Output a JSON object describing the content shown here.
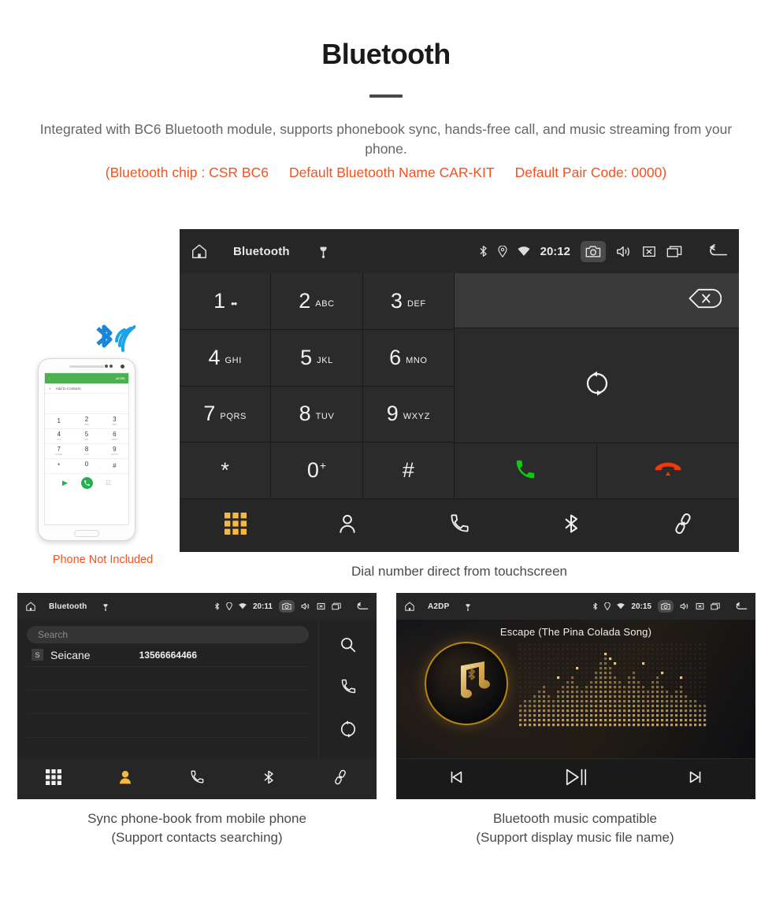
{
  "header": {
    "title": "Bluetooth",
    "description": "Integrated with BC6 Bluetooth module, supports phonebook sync, hands-free call, and music streaming from your phone.",
    "spec_open": "(Bluetooth chip : CSR BC6",
    "spec_name": "Default Bluetooth Name CAR-KIT",
    "spec_pair": "Default Pair Code: 0000)",
    "accent_color": "#f4511e",
    "text_color": "#666666"
  },
  "main_screen": {
    "statusbar": {
      "home_icon": "home-icon",
      "title": "Bluetooth",
      "usb_icon": "usb-icon",
      "bluetooth_icon": "bluetooth-icon",
      "location_icon": "location-icon",
      "wifi_icon": "wifi-icon",
      "clock": "20:12",
      "camera_icon": "camera-icon",
      "volume_icon": "volume-icon",
      "mute_icon": "mute-icon",
      "recents_icon": "recents-icon",
      "back_icon": "back-icon"
    },
    "keypad": [
      {
        "digit": "1",
        "letters": "",
        "voicemail": "oo"
      },
      {
        "digit": "2",
        "letters": "ABC",
        "voicemail": ""
      },
      {
        "digit": "3",
        "letters": "DEF",
        "voicemail": ""
      },
      {
        "digit": "4",
        "letters": "GHI",
        "voicemail": ""
      },
      {
        "digit": "5",
        "letters": "JKL",
        "voicemail": ""
      },
      {
        "digit": "6",
        "letters": "MNO",
        "voicemail": ""
      },
      {
        "digit": "7",
        "letters": "PQRS",
        "voicemail": ""
      },
      {
        "digit": "8",
        "letters": "TUV",
        "voicemail": ""
      },
      {
        "digit": "9",
        "letters": "WXYZ",
        "voicemail": ""
      },
      {
        "digit": "*",
        "letters": "",
        "voicemail": ""
      },
      {
        "digit": "0",
        "letters": "",
        "voicemail": "",
        "sup": "+"
      },
      {
        "digit": "#",
        "letters": "",
        "voicemail": ""
      }
    ],
    "number_field_value": "",
    "backspace_icon": "backspace-icon",
    "sync_icon": "sync-icon",
    "call_icon": "call-icon",
    "hangup_icon": "hangup-icon",
    "call_color": "#12c712",
    "hangup_color": "#f0380c",
    "tabs": [
      {
        "name": "dialpad",
        "icon": "dialpad-icon",
        "active": true
      },
      {
        "name": "contacts",
        "icon": "contact-icon",
        "active": false
      },
      {
        "name": "history",
        "icon": "phone-icon",
        "active": false
      },
      {
        "name": "bluetooth",
        "icon": "bluetooth-icon",
        "active": false
      },
      {
        "name": "link",
        "icon": "link-icon",
        "active": false
      }
    ],
    "active_tab_color": "#f5b942"
  },
  "contacts_screen": {
    "statusbar": {
      "title": "Bluetooth",
      "clock": "20:11"
    },
    "search": {
      "placeholder": "Search",
      "value": ""
    },
    "contacts": [
      {
        "initial": "S",
        "name": "Seicane",
        "number": "13566664466"
      }
    ],
    "rail": [
      {
        "name": "search",
        "icon": "search-icon"
      },
      {
        "name": "call",
        "icon": "phone-icon"
      },
      {
        "name": "sync",
        "icon": "sync-icon"
      }
    ],
    "tabs": [
      {
        "name": "dialpad",
        "icon": "dialpad-icon",
        "active": false
      },
      {
        "name": "contacts",
        "icon": "contact-icon",
        "active": true
      },
      {
        "name": "history",
        "icon": "phone-icon",
        "active": false
      },
      {
        "name": "bluetooth",
        "icon": "bluetooth-icon",
        "active": false
      },
      {
        "name": "link",
        "icon": "link-icon",
        "active": false
      }
    ]
  },
  "music_screen": {
    "statusbar": {
      "title": "A2DP",
      "clock": "20:15"
    },
    "song_title": "Escape (The Pina Colada Song)",
    "album_icon": "music-note-bluetooth-icon",
    "controls": [
      {
        "name": "previous",
        "icon": "skip-previous-icon"
      },
      {
        "name": "play-pause",
        "icon": "play-pause-icon"
      },
      {
        "name": "next",
        "icon": "skip-next-icon"
      }
    ]
  },
  "phone_mock": {
    "topbar_back": "back-icon",
    "topbar_more": "MORE",
    "add_label": "Add to Contacts",
    "keys": [
      {
        "d": "1",
        "s": ""
      },
      {
        "d": "2",
        "s": "ABC"
      },
      {
        "d": "3",
        "s": "DEF"
      },
      {
        "d": "4",
        "s": "GHI"
      },
      {
        "d": "5",
        "s": "JKL"
      },
      {
        "d": "6",
        "s": "MNO"
      },
      {
        "d": "7",
        "s": "PQRS"
      },
      {
        "d": "8",
        "s": "TUV"
      },
      {
        "d": "9",
        "s": "WXYZ"
      },
      {
        "d": "*",
        "s": ""
      },
      {
        "d": "0",
        "s": "+"
      },
      {
        "d": "#",
        "s": ""
      }
    ],
    "note": "Phone Not Included",
    "bluetooth_icon": "bluetooth-wireless-icon"
  },
  "captions": {
    "main": "Dial number direct from touchscreen",
    "left_line1": "Sync phone-book from mobile phone",
    "left_line2": "(Support contacts searching)",
    "right_line1": "Bluetooth music compatible",
    "right_line2": "(Support display music file name)"
  }
}
